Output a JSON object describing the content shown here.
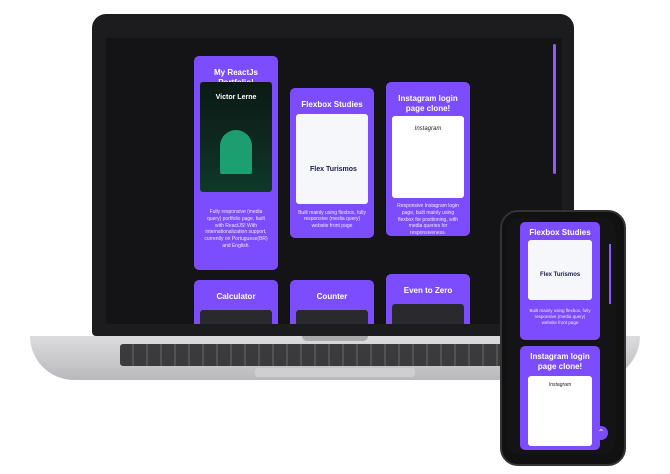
{
  "portfolio": {
    "cards": [
      {
        "title": "My ReactJs Portfolio!",
        "desc": "Fully responsive (media query) portfolio page, built with ReactJS! With internationalization support, currently on Portuguese(BR) and English."
      },
      {
        "title": "Flexbox Studies",
        "desc": "Built mainly using flexbox, fully responsive (media query) website front page"
      },
      {
        "title": "Instagram login page clone!",
        "desc": "Responsive Instagram login page, built mainly using flexbox for positioning, with media queries for responsiveness."
      },
      {
        "title": "Calculator"
      },
      {
        "title": "Counter"
      },
      {
        "title": "Even to Zero"
      }
    ],
    "thumb_portfolio": {
      "name": "Victor Lerne"
    },
    "thumb_flex": {
      "brand": "Flex Turismos"
    },
    "thumb_instagram": {
      "logo": "Instagram"
    }
  },
  "phone": {
    "cards": [
      {
        "title": "Flexbox Studies",
        "desc": "Built mainly using flexbox, fully responsive (media query) website front page"
      },
      {
        "title": "Instagram login page clone!"
      }
    ],
    "fab": "⌃"
  },
  "colors": {
    "accent": "#7c4dff",
    "screen_bg": "#141416"
  }
}
